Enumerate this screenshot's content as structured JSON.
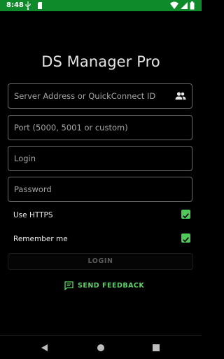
{
  "status_bar": {
    "time": "8:48",
    "background_color": "#0e8a2b",
    "left_icons": [
      "usb-icon",
      "sd-card-icon"
    ],
    "right_icons": [
      "wifi-icon",
      "signal-icon",
      "battery-icon"
    ]
  },
  "app": {
    "title": "DS Manager Pro",
    "accent_color": "#4fc95a"
  },
  "form": {
    "server_placeholder": "Server Address or QuickConnect ID",
    "port_placeholder": "Port (5000, 5001 or custom)",
    "login_placeholder": "Login",
    "password_placeholder": "Password",
    "https_label": "Use HTTPS",
    "https_checked": true,
    "remember_label": "Remember me",
    "remember_checked": true,
    "login_button": "LOGIN",
    "feedback_button": "SEND FEEDBACK"
  },
  "nav_bar": {
    "buttons": [
      "back-icon",
      "home-icon",
      "recents-icon"
    ]
  }
}
